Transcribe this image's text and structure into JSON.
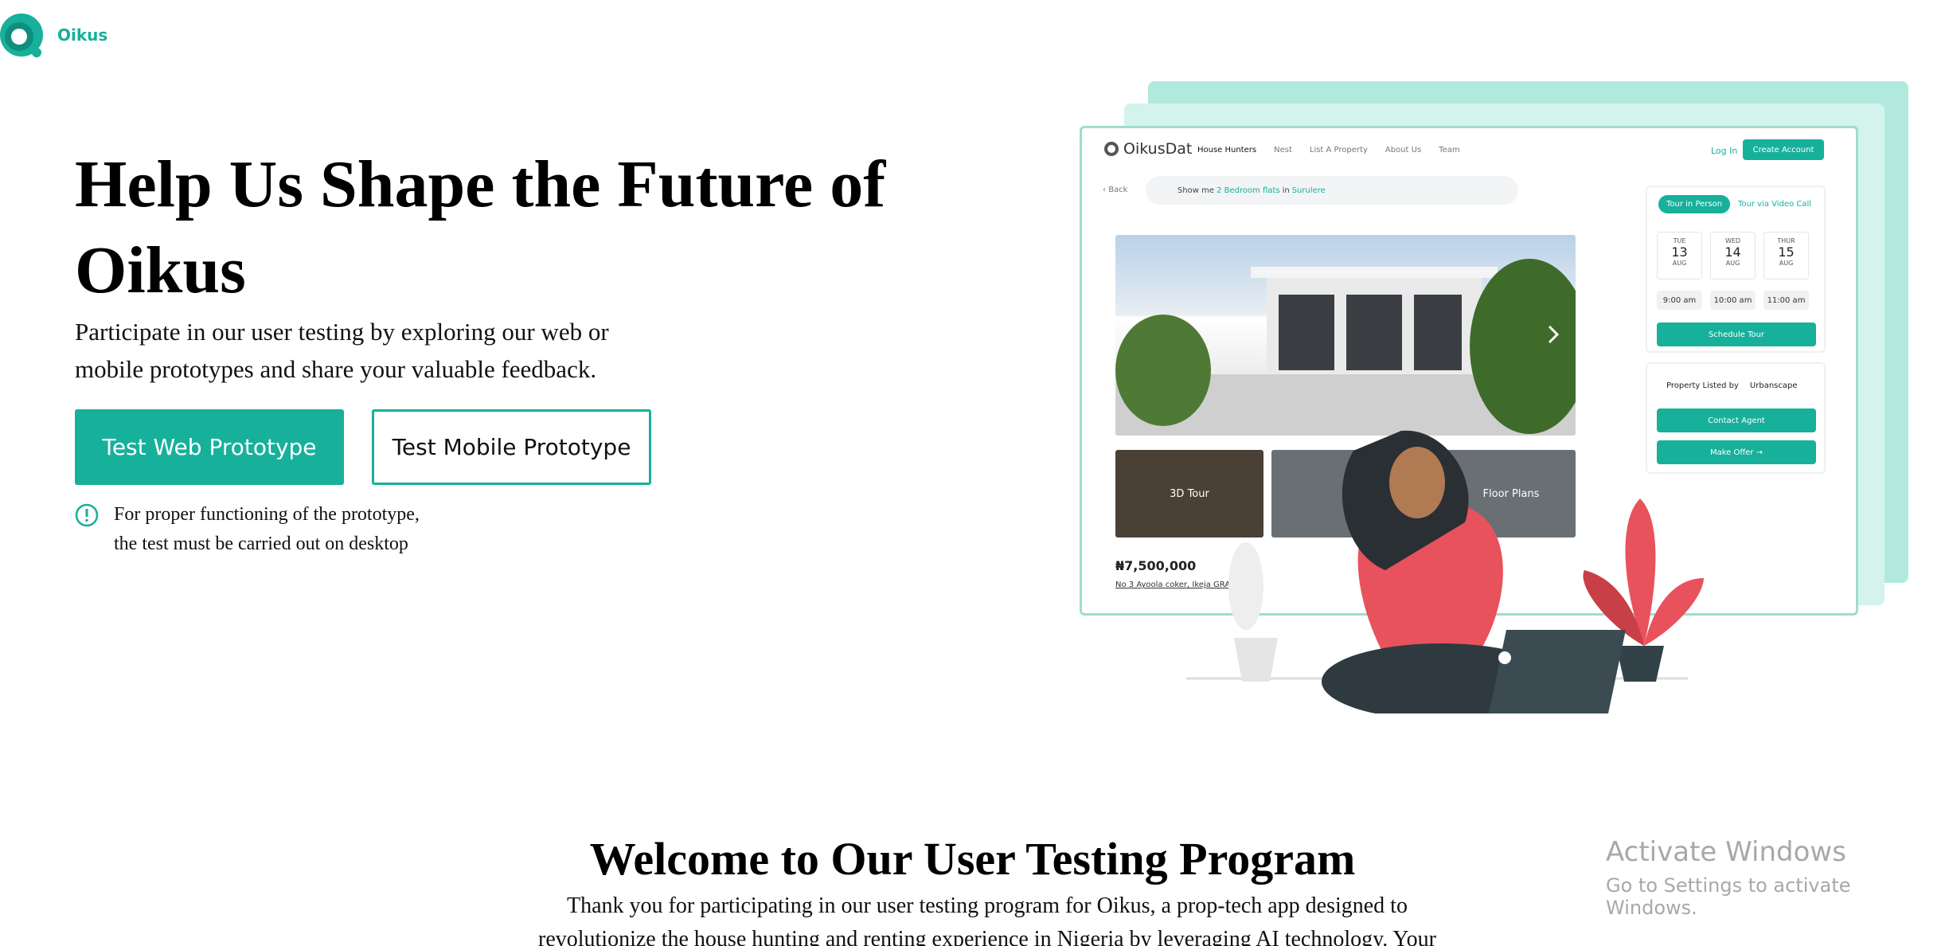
{
  "brand": {
    "name": "Oikus",
    "accent": "#17b09b"
  },
  "hero": {
    "title": "Help Us Shape the Future of Oikus",
    "subtitle": "Participate in our user testing by exploring our web or mobile prototypes and share your valuable feedback.",
    "web_button": "Test Web Prototype",
    "mobile_button": "Test Mobile Prototype",
    "notice_line1": "For proper functioning of the prototype,",
    "notice_line2": "the test must be carried out on desktop",
    "notice_icon": "info-circle-icon"
  },
  "mockup": {
    "brand": "OikusDat",
    "nav": [
      "House Hunters",
      "Nest",
      "List A Property",
      "About Us",
      "Team"
    ],
    "login": "Log In",
    "create_account": "Create Account",
    "back": "Back",
    "search_prefix": "Show me",
    "search_highlight1": "2 Bedroom flats",
    "search_mid": "in",
    "search_highlight2": "Surulere",
    "tour_tabs": [
      "Tour in Person",
      "Tour via Video Call"
    ],
    "dates": [
      {
        "day": "TUE",
        "num": "13",
        "month": "AUG"
      },
      {
        "day": "WED",
        "num": "14",
        "month": "AUG"
      },
      {
        "day": "THUR",
        "num": "15",
        "month": "AUG"
      }
    ],
    "times": [
      "9:00 am",
      "10:00 am",
      "11:00 am"
    ],
    "schedule_tour": "Schedule Tour",
    "listed_by": "Property Listed by",
    "lister": "Urbanscape",
    "contact_agent": "Contact Agent",
    "make_offer": "Make Offer →",
    "thumb1": "3D Tour",
    "thumb2": "Floor Plans",
    "price": "₦7,500,000",
    "address": "No 3 Ayoola coker, Ikeja GRA, Lagos"
  },
  "welcome": {
    "title": "Welcome to Our User Testing Program",
    "text": "Thank you for participating in our user testing program for Oikus, a prop-tech app designed to revolutionize the house hunting and renting experience in Nigeria by leveraging AI technology. Your"
  },
  "watermark": {
    "line1": "Activate Windows",
    "line2": "Go to Settings to activate Windows."
  }
}
